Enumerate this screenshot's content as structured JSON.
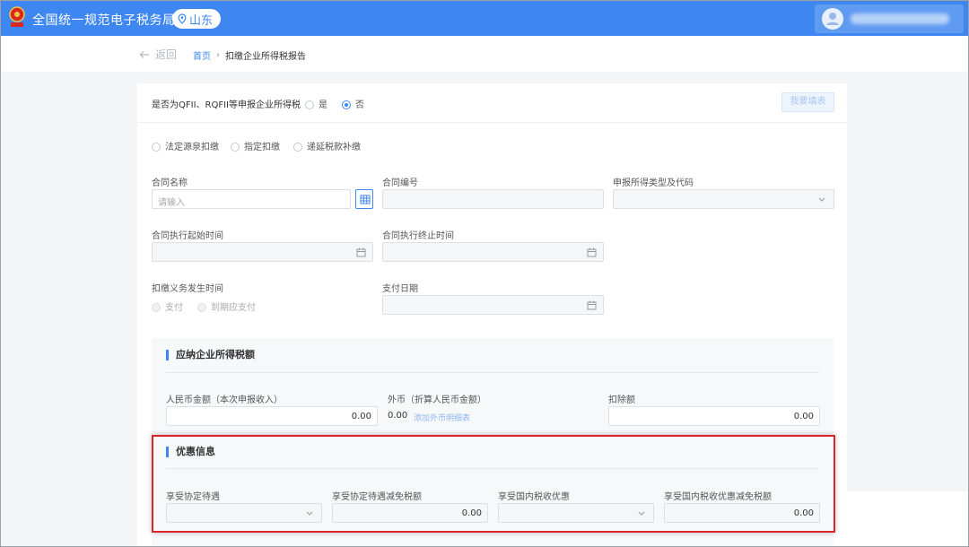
{
  "header": {
    "app_title": "全国统一规范电子税务局",
    "region": "山东",
    "brand_color": "#3e86f0"
  },
  "nav": {
    "back_label": "返回",
    "breadcrumb_home": "首页",
    "breadcrumb_current": "扣缴企业所得税报告"
  },
  "qfii": {
    "question": "是否为QFII、RQFII等申报企业所得税",
    "options": [
      "是",
      "否"
    ],
    "selected": "否",
    "action_button": "我要填表"
  },
  "withholding_types": [
    "法定源泉扣缴",
    "指定扣缴",
    "递延税款补缴"
  ],
  "form": {
    "contract_name": {
      "label": "合同名称",
      "placeholder": "请输入",
      "value": ""
    },
    "contract_no": {
      "label": "合同编号",
      "value": ""
    },
    "income_type": {
      "label": "申报所得类型及代码",
      "value": ""
    },
    "start_date": {
      "label": "合同执行起始时间",
      "value": ""
    },
    "end_date": {
      "label": "合同执行终止时间",
      "value": ""
    },
    "obligation_time": {
      "label": "扣缴义务发生时间",
      "options": [
        "支付",
        "到期应支付"
      ]
    },
    "pay_date": {
      "label": "支付日期",
      "value": ""
    }
  },
  "tax_section": {
    "title": "应纳企业所得税额",
    "rmb_amount": {
      "label": "人民币金额（本次申报收入）",
      "value": "0.00"
    },
    "foreign_currency": {
      "label": "外币（折算人民币金额）",
      "value": "0.00",
      "link": "添加外币明细表"
    },
    "deduction": {
      "label": "扣除额",
      "value": "0.00"
    }
  },
  "discount_section": {
    "title": "优惠信息",
    "treaty": {
      "label": "享受协定待遇",
      "value": ""
    },
    "treaty_relief": {
      "label": "享受协定待遇减免税额",
      "value": "0.00"
    },
    "domestic": {
      "label": "享受国内税收优惠",
      "value": ""
    },
    "domestic_relief": {
      "label": "享受国内税收优惠减免税额",
      "value": "0.00"
    }
  },
  "colors": {
    "highlight_box": "#d9262a",
    "link": "#8fb6ee"
  }
}
